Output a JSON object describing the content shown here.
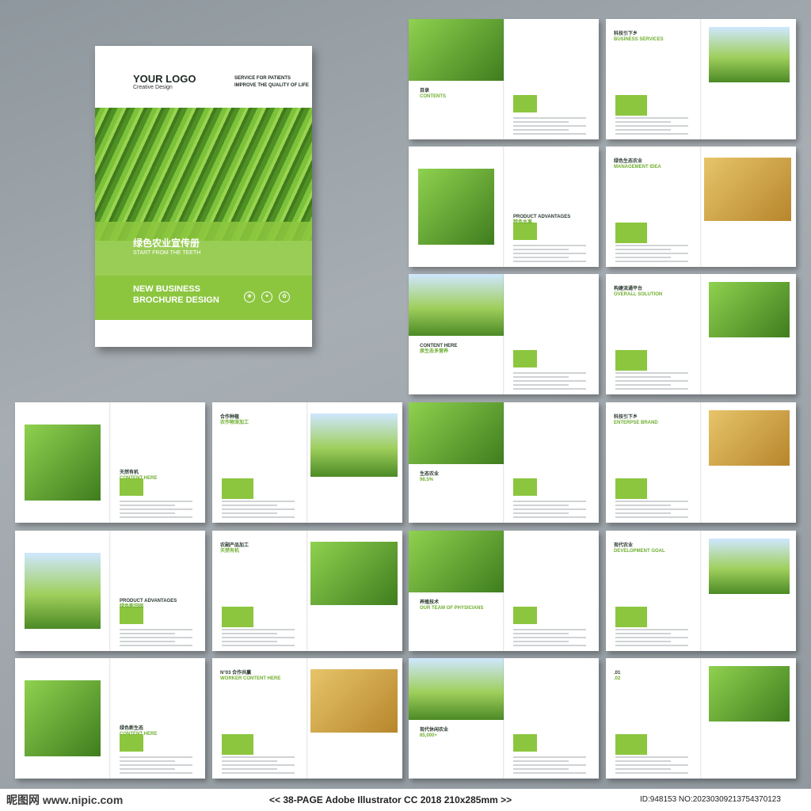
{
  "cover": {
    "logo": "YOUR LOGO",
    "logo_sub": "Creative Design",
    "tagline_1": "SERVICE FOR PATIENTS",
    "tagline_2": "IMPROVE THE QUALITY OF LIFE",
    "title_cn": "绿色农业宣传册",
    "subtitle_en": "START FROM THE TEETH",
    "title_en_1": "NEW BUSINESS",
    "title_en_2": "BROCHURE DESIGN"
  },
  "spreads": [
    {
      "label": "目录",
      "sub": "CONTENTS"
    },
    {
      "label": "科技引下乡",
      "sub": "BUSINESS SERVICES"
    },
    {
      "label": "PRODUCT ADVANTAGES",
      "sub": "特色水果"
    },
    {
      "label": "绿色生态农业",
      "sub": "MANAGEMENT IDEA"
    },
    {
      "label": "CONTENT HERE",
      "sub": "原生态多营养"
    },
    {
      "label": "构建流通平台",
      "sub": "OVERALL SOLUTION"
    },
    {
      "label": "天然有机",
      "sub": "CONTENT HERE"
    },
    {
      "label": "合作种植",
      "sub": "农作物深加工"
    },
    {
      "label": "生态农业",
      "sub": "98.5%"
    },
    {
      "label": "科技引下乡",
      "sub": "ENTERPSE BRAND"
    },
    {
      "label": "PRODUCT ADVANTAGES",
      "sub": "绿色新田园"
    },
    {
      "label": "农副产品加工",
      "sub": "天然有机"
    },
    {
      "label": "养殖技术",
      "sub": "OUR TEAM OF PHYSICIANS"
    },
    {
      "label": "现代农业",
      "sub": "DEVELOPMENT GOAL"
    },
    {
      "label": "绿色新生态",
      "sub": "CONTENT HERE"
    },
    {
      "label": "N°03 合作共赢",
      "sub": "WORKER CONTENT HERE"
    },
    {
      "label": "现代休闲农业",
      "sub": "85,000+"
    },
    {
      "label": ".01",
      "sub": ".02"
    }
  ],
  "footer": {
    "logo": "昵图网 www.nipic.com",
    "center": "<< 38-PAGE  Adobe Illustrator CC 2018  210x285mm >>",
    "id": "ID:948153 NO:20230309213754370123"
  }
}
